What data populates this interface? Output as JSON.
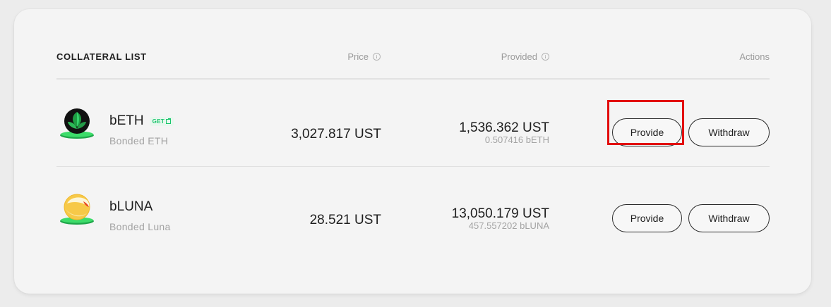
{
  "header": {
    "title": "COLLATERAL LIST",
    "price_label": "Price",
    "provided_label": "Provided",
    "actions_label": "Actions"
  },
  "rows": [
    {
      "symbol": "bETH",
      "badge": "GET",
      "name": "Bonded ETH",
      "icon": "beth-icon",
      "price": "3,027.817 UST",
      "provided_main": "1,536.362 UST",
      "provided_sub": "0.507416 bETH",
      "provide_label": "Provide",
      "withdraw_label": "Withdraw"
    },
    {
      "symbol": "bLUNA",
      "name": "Bonded Luna",
      "icon": "bluna-icon",
      "price": "28.521 UST",
      "provided_main": "13,050.179 UST",
      "provided_sub": "457.557202 bLUNA",
      "provide_label": "Provide",
      "withdraw_label": "Withdraw"
    }
  ],
  "colors": {
    "accent_green": "#19c56b",
    "highlight_red": "#e20d0d",
    "card_bg": "#f4f4f4"
  }
}
